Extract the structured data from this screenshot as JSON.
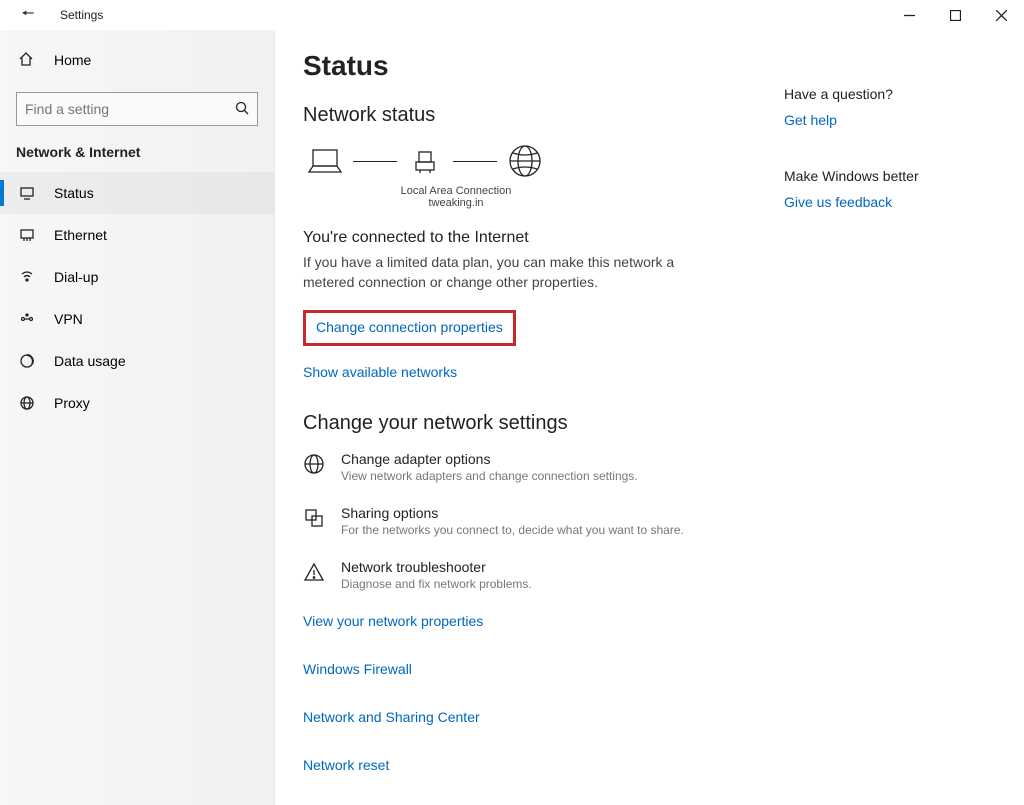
{
  "window": {
    "title": "Settings"
  },
  "sidebar": {
    "home": "Home",
    "search_placeholder": "Find a setting",
    "section": "Network & Internet",
    "items": [
      {
        "label": "Status"
      },
      {
        "label": "Ethernet"
      },
      {
        "label": "Dial-up"
      },
      {
        "label": "VPN"
      },
      {
        "label": "Data usage"
      },
      {
        "label": "Proxy"
      }
    ]
  },
  "main": {
    "title": "Status",
    "network_status_heading": "Network status",
    "connection_name": "Local Area Connection",
    "connection_sub": "tweaking.in",
    "connected_heading": "You're connected to the Internet",
    "connected_body": "If you have a limited data plan, you can make this network a metered connection or change other properties.",
    "change_props": "Change connection properties",
    "show_networks": "Show available networks",
    "change_settings_heading": "Change your network settings",
    "rows": [
      {
        "title": "Change adapter options",
        "desc": "View network adapters and change connection settings."
      },
      {
        "title": "Sharing options",
        "desc": "For the networks you connect to, decide what you want to share."
      },
      {
        "title": "Network troubleshooter",
        "desc": "Diagnose and fix network problems."
      }
    ],
    "links": [
      "View your network properties",
      "Windows Firewall",
      "Network and Sharing Center",
      "Network reset"
    ]
  },
  "right": {
    "question": "Have a question?",
    "get_help": "Get help",
    "better": "Make Windows better",
    "feedback": "Give us feedback"
  }
}
